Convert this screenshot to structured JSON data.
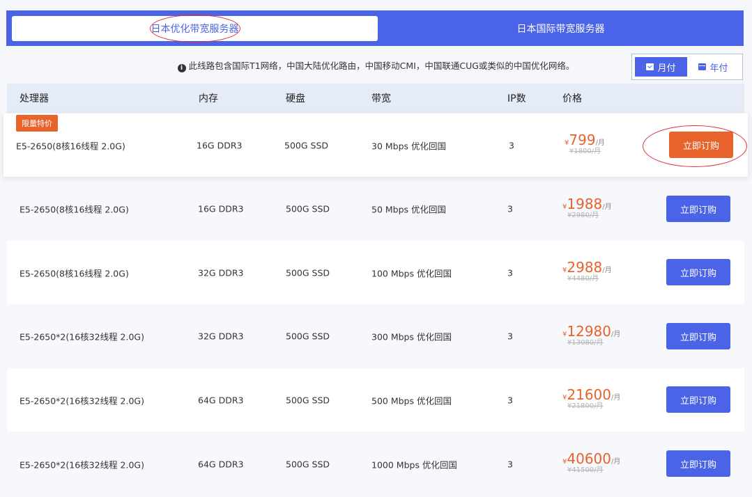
{
  "tabs": [
    {
      "label": "日本优化带宽服务器"
    },
    {
      "label": "日本国际带宽服务器"
    }
  ],
  "notice": "此线路包含国际T1网络，中国大陆优化路由，中国移动CMI，中国联通CUG或类似的中国优化网络。",
  "billing": {
    "monthly": "月付",
    "yearly": "年付"
  },
  "table": {
    "headers": [
      "处理器",
      "内存",
      "硬盘",
      "带宽",
      "IP数",
      "价格"
    ],
    "rows": [
      {
        "badge": "限量特价",
        "cpu": "E5-2650(8核16线程 2.0G)",
        "ram": "16G DDR3",
        "disk": "500G SSD",
        "bw": "30 Mbps 优化回国",
        "ip": "3",
        "currency": "¥",
        "price": "799",
        "unit": "/月",
        "orig": "¥1800/月",
        "buy": "立即订购"
      },
      {
        "cpu": "E5-2650(8核16线程 2.0G)",
        "ram": "16G DDR3",
        "disk": "500G SSD",
        "bw": "50 Mbps 优化回国",
        "ip": "3",
        "currency": "¥",
        "price": "1988",
        "unit": "/月",
        "orig": "¥2980/月",
        "buy": "立即订购"
      },
      {
        "cpu": "E5-2650(8核16线程 2.0G)",
        "ram": "32G DDR3",
        "disk": "500G SSD",
        "bw": "100 Mbps 优化回国",
        "ip": "3",
        "currency": "¥",
        "price": "2988",
        "unit": "/月",
        "orig": "¥4480/月",
        "buy": "立即订购"
      },
      {
        "cpu": "E5-2650*2(16核32线程 2.0G)",
        "ram": "32G DDR3",
        "disk": "500G SSD",
        "bw": "300 Mbps 优化回国",
        "ip": "3",
        "currency": "¥",
        "price": "12980",
        "unit": "/月",
        "orig": "¥13080/月",
        "buy": "立即订购"
      },
      {
        "cpu": "E5-2650*2(16核32线程 2.0G)",
        "ram": "64G DDR3",
        "disk": "500G SSD",
        "bw": "500 Mbps 优化回国",
        "ip": "3",
        "currency": "¥",
        "price": "21600",
        "unit": "/月",
        "orig": "¥21800/月",
        "buy": "立即订购"
      },
      {
        "cpu": "E5-2650*2(16核32线程 2.0G)",
        "ram": "64G DDR3",
        "disk": "500G SSD",
        "bw": "1000 Mbps 优化回国",
        "ip": "3",
        "currency": "¥",
        "price": "40600",
        "unit": "/月",
        "orig": "¥41500/月",
        "buy": "立即订购"
      }
    ]
  },
  "colors": {
    "accent": "#4b63e6",
    "highlight": "#e8622b",
    "annotation": "#d9303a"
  }
}
